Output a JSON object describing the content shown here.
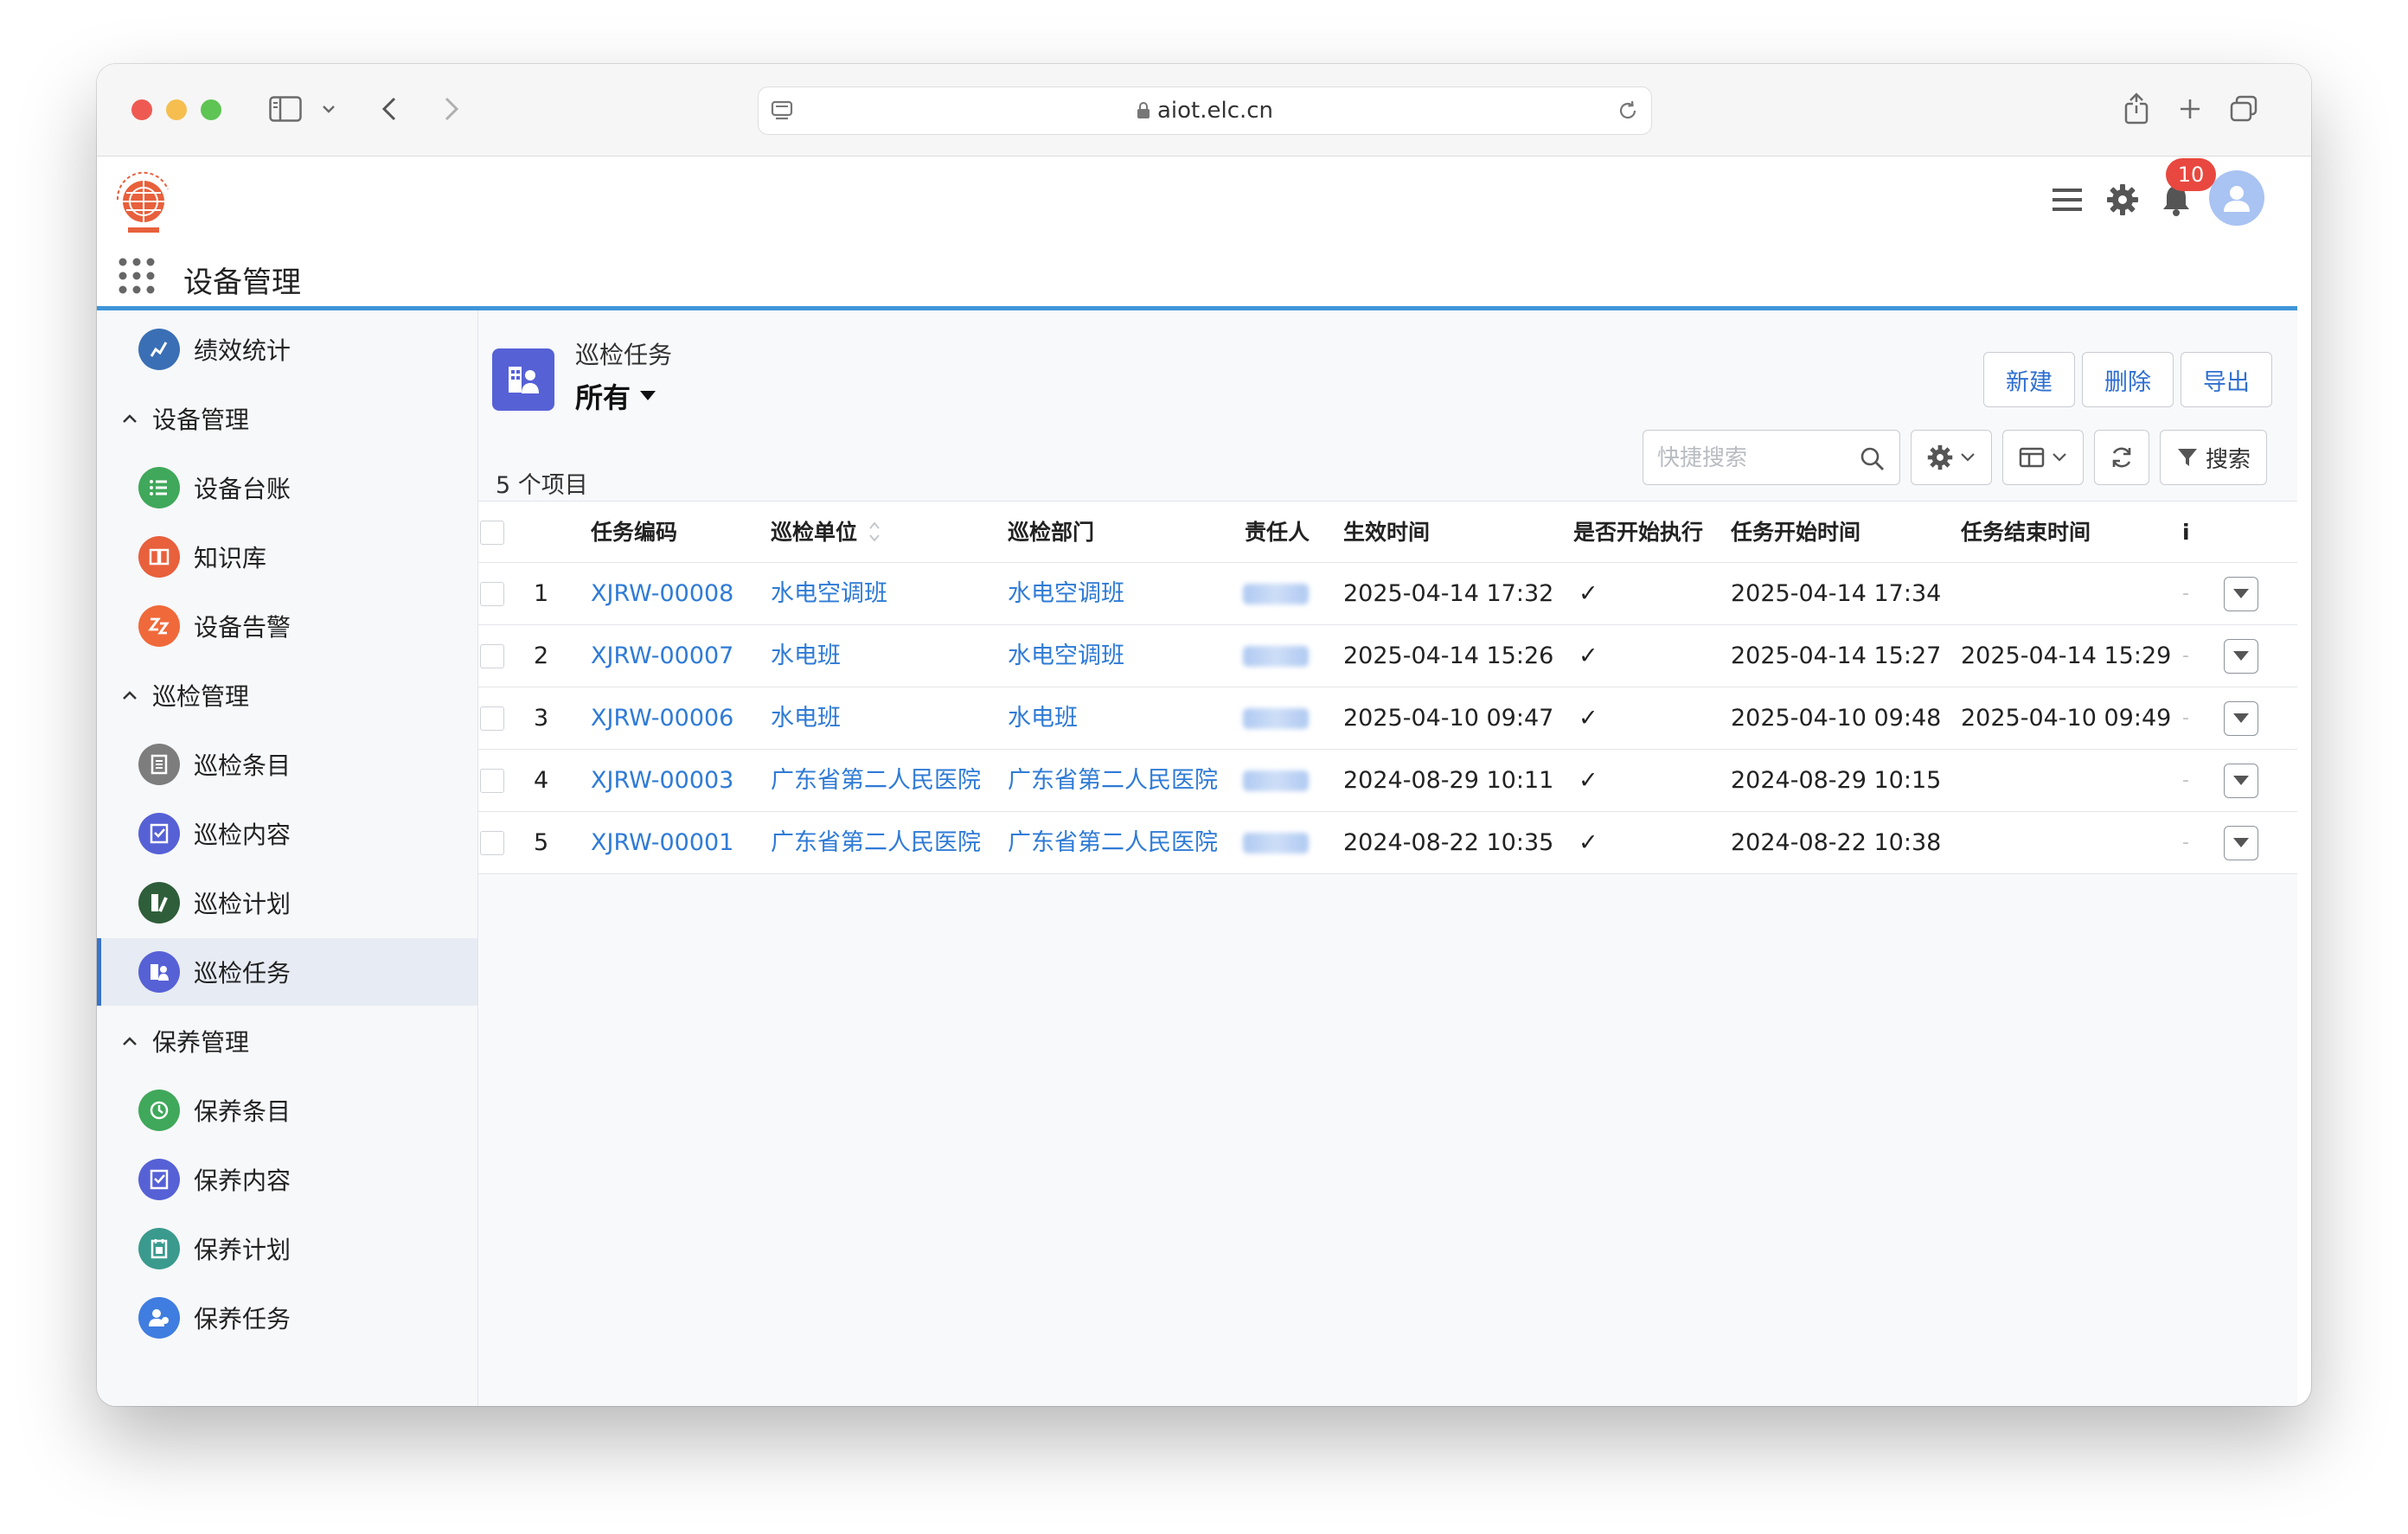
{
  "browser": {
    "url": "aiot.elc.cn"
  },
  "header": {
    "module_title": "设备管理",
    "notification_count": "10"
  },
  "sidebar": {
    "items": [
      {
        "label": "绩效统计",
        "icon": "chart-icon",
        "color": "#3a6fb5"
      },
      {
        "group": "设备管理"
      },
      {
        "label": "设备台账",
        "icon": "list-icon",
        "color": "#3fa85a"
      },
      {
        "label": "知识库",
        "icon": "book-icon",
        "color": "#e8603c"
      },
      {
        "label": "设备告警",
        "icon": "alarm-icon",
        "color": "#f0693a"
      },
      {
        "group": "巡检管理"
      },
      {
        "label": "巡检条目",
        "icon": "document-icon",
        "color": "#7d7d7d"
      },
      {
        "label": "巡检内容",
        "icon": "checklist-icon",
        "color": "#5661d6"
      },
      {
        "label": "巡检计划",
        "icon": "plan-icon",
        "color": "#2f5e3a"
      },
      {
        "label": "巡检任务",
        "icon": "task-icon",
        "color": "#5661d6",
        "active": true
      },
      {
        "group": "保养管理"
      },
      {
        "label": "保养条目",
        "icon": "clock-icon",
        "color": "#3fa85a"
      },
      {
        "label": "保养内容",
        "icon": "checklist-icon",
        "color": "#5661d6"
      },
      {
        "label": "保养计划",
        "icon": "calendar-icon",
        "color": "#3a9a8e"
      },
      {
        "label": "保养任务",
        "icon": "users-icon",
        "color": "#3f7de0"
      }
    ]
  },
  "main": {
    "object_label": "巡检任务",
    "view_label": "所有",
    "item_count": "5 个项目",
    "buttons": {
      "new": "新建",
      "delete": "删除",
      "export": "导出"
    },
    "search": {
      "placeholder": "快捷搜索",
      "button_label": "搜索"
    }
  },
  "table": {
    "columns": [
      "任务编码",
      "巡检单位",
      "巡检部门",
      "责任人",
      "生效时间",
      "是否开始执行",
      "任务开始时间",
      "任务结束时间",
      "i"
    ],
    "rows": [
      {
        "index": "1",
        "code": "XJRW-00008",
        "unit": "水电空调班",
        "dept": "水电空调班",
        "effective": "2025-04-14 17:32",
        "started": "✓",
        "start_time": "2025-04-14 17:34",
        "end_time": "",
        "extra": "-"
      },
      {
        "index": "2",
        "code": "XJRW-00007",
        "unit": "水电班",
        "dept": "水电空调班",
        "effective": "2025-04-14 15:26",
        "started": "✓",
        "start_time": "2025-04-14 15:27",
        "end_time": "2025-04-14 15:29",
        "extra": "-"
      },
      {
        "index": "3",
        "code": "XJRW-00006",
        "unit": "水电班",
        "dept": "水电班",
        "effective": "2025-04-10 09:47",
        "started": "✓",
        "start_time": "2025-04-10 09:48",
        "end_time": "2025-04-10 09:49",
        "extra": "-"
      },
      {
        "index": "4",
        "code": "XJRW-00003",
        "unit": "广东省第二人民医院",
        "dept": "广东省第二人民医院",
        "effective": "2024-08-29 10:11",
        "started": "✓",
        "start_time": "2024-08-29 10:15",
        "end_time": "",
        "extra": "-"
      },
      {
        "index": "5",
        "code": "XJRW-00001",
        "unit": "广东省第二人民医院",
        "dept": "广东省第二人民医院",
        "effective": "2024-08-22 10:35",
        "started": "✓",
        "start_time": "2024-08-22 10:38",
        "end_time": "",
        "extra": "-"
      }
    ]
  },
  "colors": {
    "accent": "#3f95d8",
    "link": "#2f7bd6",
    "badge": "#e8483f",
    "page_icon": "#5661d6"
  }
}
